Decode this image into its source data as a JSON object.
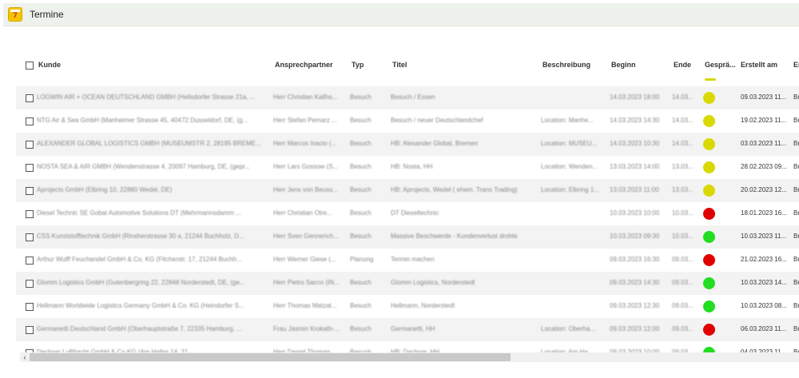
{
  "window": {
    "title": "Termine",
    "icon": "calendar-icon",
    "icon_number": "7"
  },
  "colors": {
    "yellow": "#d9d900",
    "red": "#e00000",
    "green": "#22dd22",
    "row_alt": "#f3f3f3"
  },
  "table": {
    "headers": [
      "Kunde",
      "Ansprechpartner",
      "Typ",
      "Titel",
      "Beschreibung",
      "Beginn",
      "Ende",
      "Gesprä...",
      "Erstellt am",
      "Er"
    ],
    "rows": [
      {
        "kunde": "LOGWIN AIR + OCEAN DEUTSCHLAND GMBH (Hellsdorfer Strasse 21a, ...",
        "ansprech": "Herr Christian Kallho...",
        "typ": "Besuch",
        "titel": "Besuch / Essen",
        "beschreibung": "",
        "beginn": "14.03.2023 18:00",
        "ende": "14.03...",
        "status": "yellow",
        "erstellt": "09.03.2023 11...",
        "er": "Br"
      },
      {
        "kunde": "NTG Air & Sea GmbH (Manheimer Strasse 45, 40472 Dusseldorf, DE, (g...",
        "ansprech": "Herr Stefan Pemarz ...",
        "typ": "Besuch",
        "titel": "Besuch / neuer Deutschlandchef",
        "beschreibung": "Location: Manhe...",
        "beginn": "14.03.2023 14:30",
        "ende": "14.03...",
        "status": "yellow",
        "erstellt": "19.02.2023 11...",
        "er": "Br"
      },
      {
        "kunde": "ALEXANDER GLOBAL LOGISTICS GMBH (MUSEUMSTR 2, 28195 BREME...",
        "ansprech": "Herr Marcos Inacio (...",
        "typ": "Besuch",
        "titel": "HB: Alexander Global, Bremen",
        "beschreibung": "Location: MUSEU...",
        "beginn": "14.03.2023 10:30",
        "ende": "14.03...",
        "status": "yellow",
        "erstellt": "03.03.2023 11...",
        "er": "Br"
      },
      {
        "kunde": "NOSTA SEA & AIR GMBH (Wendenstrasse 4, 20097 Hamburg, DE, (gepr...",
        "ansprech": "Herr Lars Gossow (S...",
        "typ": "Besuch",
        "titel": "HB: Nosta, HH",
        "beschreibung": "Location: Wenden...",
        "beginn": "13.03.2023 14:00",
        "ende": "13.03...",
        "status": "yellow",
        "erstellt": "28.02.2023 09...",
        "er": "Br"
      },
      {
        "kunde": "Aprojects GmbH (Elbring 10, 22880 Wedel, DE)",
        "ansprech": "Herr Jens von Beuss...",
        "typ": "Besuch",
        "titel": "HB: Aprojects, Wedel ( ehem. Trans Trading)",
        "beschreibung": "Location: Elbring 1...",
        "beginn": "13.03.2023 11:00",
        "ende": "13.03...",
        "status": "yellow",
        "erstellt": "20.02.2023 12...",
        "er": "Br"
      },
      {
        "kunde": "Diesel Technic SE Gobal Automotive Solutions DT (Mehrmannsdamm ...",
        "ansprech": "Herr Christian Otre...",
        "typ": "Besuch",
        "titel": "DT Dieseltechnic",
        "beschreibung": "",
        "beginn": "10.03.2023 10:00",
        "ende": "10.03...",
        "status": "red",
        "erstellt": "18.01.2023 16...",
        "er": "Br"
      },
      {
        "kunde": "CSS Kunststofftechnik GmbH (Rinsherstrasse 30 a, 21244 Buchholz, D...",
        "ansprech": "Herr Sven Gennerich...",
        "typ": "Besuch",
        "titel": "Massive Beschwerde - Kundenverlust drohte",
        "beschreibung": "",
        "beginn": "10.03.2023 09:30",
        "ende": "10.03...",
        "status": "green",
        "erstellt": "10.03.2023 11...",
        "er": "Br"
      },
      {
        "kunde": "Arthur Wulff Feuchandel GmbH & Co. KG (Fitcherstr. 17, 21244 Buchh...",
        "ansprech": "Herr Werner Giese (...",
        "typ": "Planung",
        "titel": "Termin machen",
        "beschreibung": "",
        "beginn": "09.03.2023 16:30",
        "ende": "09.03...",
        "status": "red",
        "erstellt": "21.02.2023 16...",
        "er": "Br"
      },
      {
        "kunde": "Glomm Logistics GmbH (Gutenbergring 22, 22848 Norderstedt, DE, (ge...",
        "ansprech": "Herr Pietro Sacco (IN...",
        "typ": "Besuch",
        "titel": "Glomm Logistics, Norderstedt",
        "beschreibung": "",
        "beginn": "09.03.2023 14:30",
        "ende": "09.03...",
        "status": "green",
        "erstellt": "10.03.2023 14...",
        "er": "Br"
      },
      {
        "kunde": "Hellmann Worldwide Logistics Germany GmbH & Co. KG (Heindorfer S...",
        "ansprech": "Herr Thomas Matzat...",
        "typ": "Besuch",
        "titel": "Hellmann, Norderstedt",
        "beschreibung": "",
        "beginn": "09.03.2023 12:30",
        "ende": "09.03...",
        "status": "green",
        "erstellt": "10.03.2023 08...",
        "er": "Br"
      },
      {
        "kunde": "Germanetti Deutschland GmbH (Oberhauptstraße 7, 22335 Hamburg, ...",
        "ansprech": "Frau Jasmin Krokath-...",
        "typ": "Besuch",
        "titel": "Germanetti, HH",
        "beschreibung": "Location: Oberha...",
        "beginn": "09.03.2023 12:00",
        "ende": "09.03...",
        "status": "red",
        "erstellt": "06.03.2023 11...",
        "er": "Br"
      },
      {
        "kunde": "Dachser Luftfracht GmbH & Co KG (Am Hafen 14, 21...",
        "ansprech": "Herr Daniel Thomas...",
        "typ": "Besuch",
        "titel": "HB: Dachser, HH",
        "beschreibung": "Location: Am Ha...",
        "beginn": "09.03.2023 10:00",
        "ende": "09.03...",
        "status": "green",
        "erstellt": "04.03.2023 11...",
        "er": "Br"
      }
    ]
  },
  "scrollbar": {
    "left_arrow": "‹"
  }
}
